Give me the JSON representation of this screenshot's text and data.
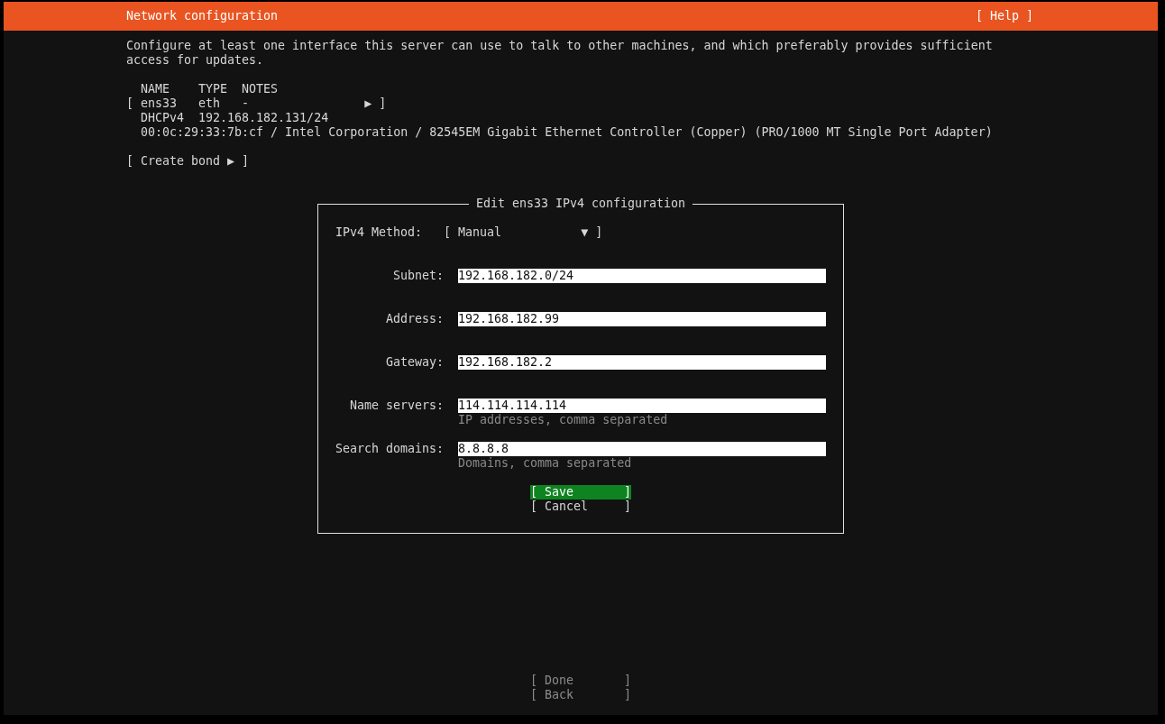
{
  "header": {
    "title": "Network configuration",
    "help": "[ Help ]"
  },
  "intro": "Configure at least one interface this server can use to talk to other machines, and which preferably provides sufficient access for updates.",
  "interfaces": {
    "columns": [
      "NAME",
      "TYPE",
      "NOTES"
    ],
    "rows": [
      {
        "line": "[ ens33   eth   -                ▶ ]",
        "details": [
          "DHCPv4  192.168.182.131/24",
          "00:0c:29:33:7b:cf / Intel Corporation / 82545EM Gigabit Ethernet Controller (Copper) (PRO/1000 MT Single Port Adapter)"
        ]
      }
    ]
  },
  "create_bond": "[ Create bond ▶ ]",
  "dialog": {
    "title": "Edit ens33 IPv4 configuration",
    "method": {
      "label": "IPv4 Method:",
      "value": "[ Manual           ▼ ]"
    },
    "fields": [
      {
        "label": "Subnet:",
        "value": "192.168.182.0/24"
      },
      {
        "label": "Address:",
        "value": "192.168.182.99"
      },
      {
        "label": "Gateway:",
        "value": "192.168.182.2"
      },
      {
        "label": "Name servers:",
        "value": "114.114.114.114",
        "hint": "IP addresses, comma separated"
      },
      {
        "label": "Search domains:",
        "value": "8.8.8.8",
        "hint": "Domains, comma separated"
      }
    ],
    "buttons": [
      {
        "label": "[ Save       ]",
        "selected": true
      },
      {
        "label": "[ Cancel     ]",
        "selected": false
      }
    ]
  },
  "footer_buttons": [
    {
      "label": "[ Done       ]",
      "disabled": true
    },
    {
      "label": "[ Back       ]",
      "disabled": true
    }
  ]
}
